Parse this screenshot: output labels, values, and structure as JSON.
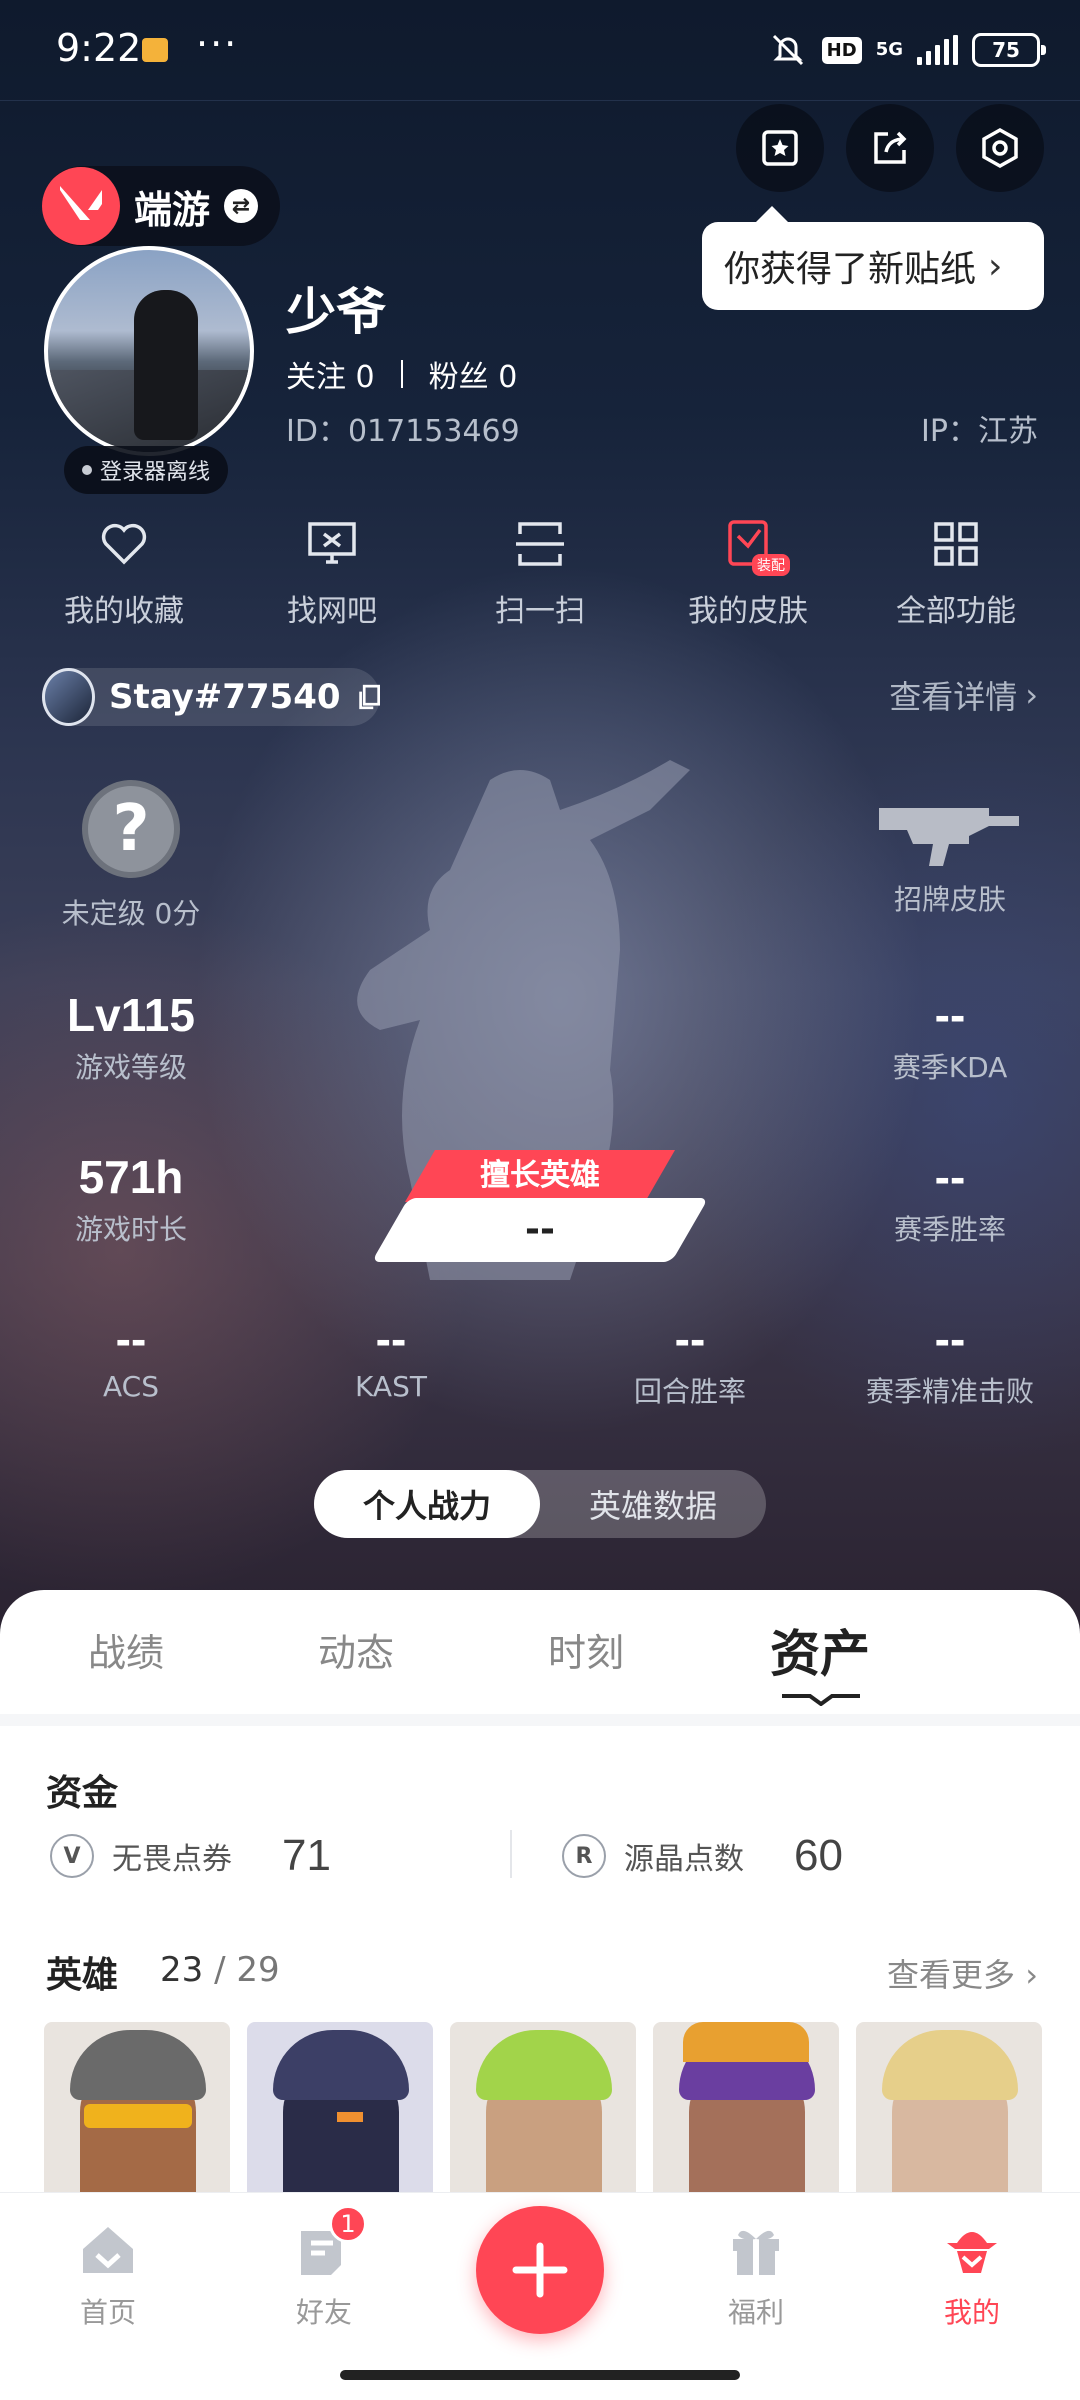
{
  "status_bar": {
    "time": "9:22",
    "dots": "···",
    "hd": "HD",
    "network": "5G",
    "battery": "75"
  },
  "header": {
    "tooltip": "你获得了新贴纸",
    "game_name": "端游"
  },
  "profile": {
    "nickname": "少爷",
    "follow_label": "关注",
    "follow_count": "0",
    "fans_label": "粉丝",
    "fans_count": "0",
    "id_text": "ID：017153469",
    "ip_text": "IP：江苏",
    "online_status": "登录器离线"
  },
  "quick_actions": [
    {
      "label": "我的收藏",
      "icon": "heart-icon"
    },
    {
      "label": "找网吧",
      "icon": "monitor-icon"
    },
    {
      "label": "扫一扫",
      "icon": "scan-icon"
    },
    {
      "label": "我的皮肤",
      "icon": "skin-icon",
      "badge": "装配"
    },
    {
      "label": "全部功能",
      "icon": "grid-icon"
    }
  ],
  "account": {
    "riot_id": "Stay#77540",
    "detail_link": "查看详情"
  },
  "stats": {
    "rank_label": "未定级 0分",
    "skin_label": "招牌皮肤",
    "level_value": "Lv115",
    "level_label": "游戏等级",
    "kda_value": "--",
    "kda_label": "赛季KDA",
    "hours_value": "571h",
    "hours_label": "游戏时长",
    "winrate_value": "--",
    "winrate_label": "赛季胜率",
    "acs_value": "--",
    "acs_label": "ACS",
    "kast_value": "--",
    "kast_label": "KAST",
    "round_value": "--",
    "round_label": "回合胜率",
    "precise_value": "--",
    "precise_label": "赛季精准击败",
    "best_hero_tag": "擅长英雄",
    "best_hero_value": "--"
  },
  "segment": {
    "left": "个人战力",
    "right": "英雄数据"
  },
  "tabs": [
    "战绩",
    "动态",
    "时刻",
    "资产"
  ],
  "assets": {
    "funds_title": "资金",
    "vp_label": "无畏点券",
    "vp_value": "71",
    "rp_label": "源晶点数",
    "rp_value": "60",
    "heroes_title": "英雄",
    "heroes_owned": "23",
    "heroes_total": "/ 29",
    "more_link": "查看更多"
  },
  "bottom_nav": {
    "home": "首页",
    "friends": "好友",
    "friends_badge": "1",
    "rewards": "福利",
    "mine": "我的"
  },
  "colors": {
    "accent": "#ff4655"
  }
}
